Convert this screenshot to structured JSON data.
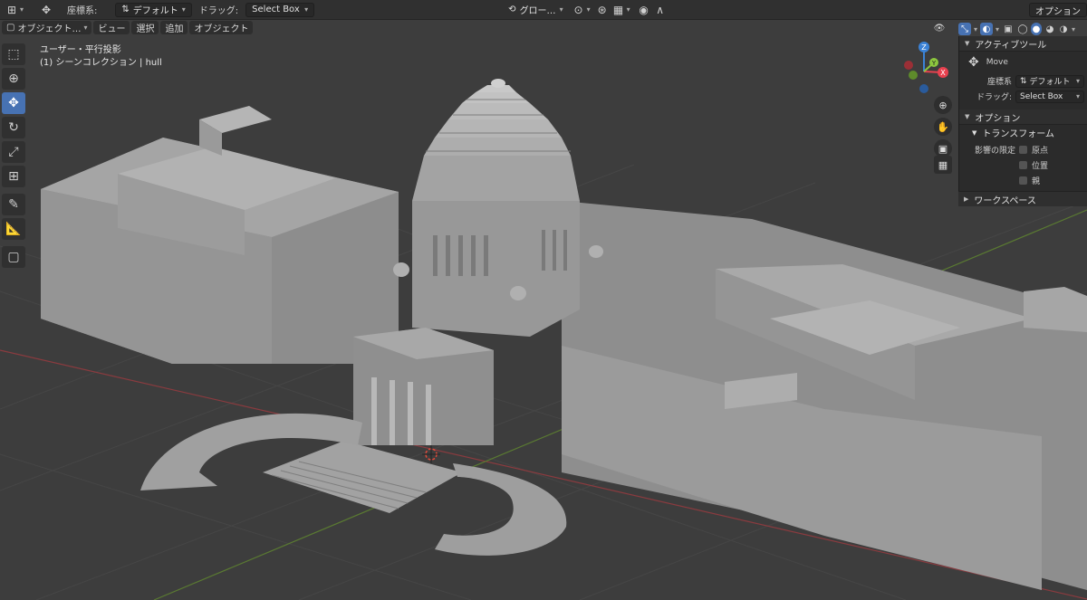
{
  "header": {
    "coord_label": "座標系:",
    "coord_value": "デフォルト",
    "drag_label": "ドラッグ:",
    "drag_value": "Select Box",
    "global_value": "グロー…",
    "options_label": "オプション"
  },
  "subheader": {
    "mode": "オブジェクト…",
    "menus": [
      "ビュー",
      "選択",
      "追加",
      "オブジェクト"
    ]
  },
  "viewport": {
    "line1": "ユーザー・平行投影",
    "line2": "(1) シーンコレクション | hull"
  },
  "gizmo": {
    "z": "Z",
    "y": "Y",
    "x": "X"
  },
  "panel": {
    "active_tool_title": "アクティブツール",
    "tool_name": "Move",
    "coord_label": "座標系",
    "coord_value": "デフォルト",
    "drag_label": "ドラッグ:",
    "drag_value": "Select Box",
    "options_title": "オプション",
    "transform_title": "トランスフォーム",
    "affect_label": "影響の限定",
    "affect_options": [
      "原点",
      "位置",
      "親"
    ],
    "workspace_title": "ワークスペース"
  },
  "icons": {
    "select": "cursor-select-icon",
    "cursor": "3d-cursor-icon",
    "move": "move-icon",
    "rotate": "rotate-icon",
    "scale": "scale-icon",
    "transform": "transform-icon",
    "annotate": "annotate-icon",
    "measure": "measure-icon",
    "add_cube": "add-cube-icon"
  },
  "colors": {
    "accent": "#4772b3",
    "x_axis": "#e8414f",
    "y_axis": "#8cc63e",
    "z_axis": "#3b82d6",
    "grid": "#454545",
    "building": "#9a9a9a"
  }
}
